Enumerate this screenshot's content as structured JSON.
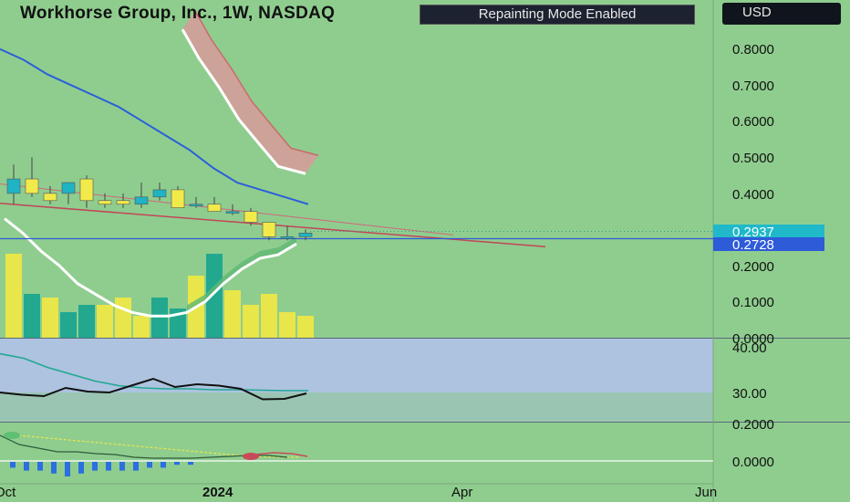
{
  "header": {
    "title": "Workhorse Group, Inc., 1W, NASDAQ",
    "mode_badge": "Repainting Mode Enabled",
    "currency": "USD"
  },
  "chart_data": [
    {
      "type": "candlestick",
      "timeframe": "1W",
      "ylim": [
        0.0,
        0.85
      ],
      "y_ticks": [
        "0.8000",
        "0.7000",
        "0.6000",
        "0.5000",
        "0.4000",
        "0.2000",
        "0.1000",
        "0.0000"
      ],
      "price_labels": [
        {
          "value": "0.2937",
          "color": "#1fb9c9"
        },
        {
          "value": "0.2728",
          "color": "#2e5bd8"
        }
      ],
      "x_ticks": [
        "Oct",
        "2024",
        "Apr",
        "Jun"
      ],
      "candles": [
        {
          "o": 0.4,
          "h": 0.48,
          "l": 0.37,
          "c": 0.44
        },
        {
          "o": 0.44,
          "h": 0.5,
          "l": 0.39,
          "c": 0.4
        },
        {
          "o": 0.4,
          "h": 0.42,
          "l": 0.37,
          "c": 0.38
        },
        {
          "o": 0.4,
          "h": 0.43,
          "l": 0.37,
          "c": 0.43
        },
        {
          "o": 0.44,
          "h": 0.45,
          "l": 0.36,
          "c": 0.38
        },
        {
          "o": 0.38,
          "h": 0.4,
          "l": 0.36,
          "c": 0.37
        },
        {
          "o": 0.38,
          "h": 0.4,
          "l": 0.36,
          "c": 0.37
        },
        {
          "o": 0.37,
          "h": 0.43,
          "l": 0.36,
          "c": 0.39
        },
        {
          "o": 0.39,
          "h": 0.43,
          "l": 0.38,
          "c": 0.41
        },
        {
          "o": 0.41,
          "h": 0.42,
          "l": 0.36,
          "c": 0.36
        },
        {
          "o": 0.37,
          "h": 0.39,
          "l": 0.36,
          "c": 0.37
        },
        {
          "o": 0.37,
          "h": 0.39,
          "l": 0.35,
          "c": 0.35
        },
        {
          "o": 0.35,
          "h": 0.37,
          "l": 0.34,
          "c": 0.35
        },
        {
          "o": 0.35,
          "h": 0.36,
          "l": 0.31,
          "c": 0.32
        },
        {
          "o": 0.32,
          "h": 0.32,
          "l": 0.27,
          "c": 0.28
        },
        {
          "o": 0.28,
          "h": 0.31,
          "l": 0.27,
          "c": 0.28
        },
        {
          "o": 0.28,
          "h": 0.3,
          "l": 0.27,
          "c": 0.29
        }
      ],
      "volumes": [
        0.23,
        0.12,
        0.11,
        0.07,
        0.09,
        0.09,
        0.11,
        0.06,
        0.11,
        0.08,
        0.17,
        0.23,
        0.13,
        0.09,
        0.12,
        0.07,
        0.06
      ],
      "ma_blue": [
        0.8,
        0.77,
        0.73,
        0.7,
        0.67,
        0.64,
        0.6,
        0.56,
        0.52,
        0.47,
        0.43,
        0.41,
        0.39,
        0.37
      ],
      "band_lower": [
        0.33,
        0.29,
        0.24,
        0.2,
        0.15,
        0.12,
        0.09,
        0.07,
        0.06,
        0.06,
        0.07,
        0.1,
        0.15,
        0.19,
        0.22,
        0.23,
        0.26
      ],
      "band_upper": [
        0.88,
        0.8,
        0.72,
        0.63,
        0.56,
        0.5,
        0.48
      ],
      "trendline_upper": [
        0.52,
        0.3
      ],
      "trendline_lower": [
        0.38,
        0.26
      ]
    },
    {
      "type": "line",
      "ylim": [
        25,
        42
      ],
      "y_ticks": [
        "40.00",
        "30.00"
      ],
      "series_black": [
        30,
        29.5,
        29.2,
        31,
        30.2,
        30,
        31.5,
        33,
        31.2,
        31.8,
        31.5,
        30.8,
        28.5,
        28.6,
        29.8
      ],
      "series_teal": [
        38.5,
        37.5,
        35.5,
        34,
        32.5,
        31.5,
        31,
        30.8,
        30.8,
        30.6,
        30.6,
        30.5,
        30.4,
        30.4
      ]
    },
    {
      "type": "bar",
      "ylim": [
        -0.05,
        0.22
      ],
      "y_ticks": [
        "0.2000",
        "0.0000"
      ],
      "histogram": [
        -0.02,
        -0.03,
        -0.03,
        -0.04,
        -0.05,
        -0.04,
        -0.03,
        -0.03,
        -0.03,
        -0.03,
        -0.02,
        -0.02,
        -0.01,
        -0.01,
        0.0
      ],
      "signal_yellow": [
        0.14,
        0.13,
        0.12,
        0.11,
        0.1,
        0.09,
        0.08,
        0.07,
        0.06,
        0.05,
        0.04,
        0.03,
        0.025,
        0.02,
        0.02
      ],
      "macd_dark": [
        0.14,
        0.09,
        0.07,
        0.05,
        0.05,
        0.04,
        0.035,
        0.02,
        0.015,
        0.015,
        0.015,
        0.02,
        0.025,
        0.03,
        0.03,
        0.02
      ]
    }
  ]
}
